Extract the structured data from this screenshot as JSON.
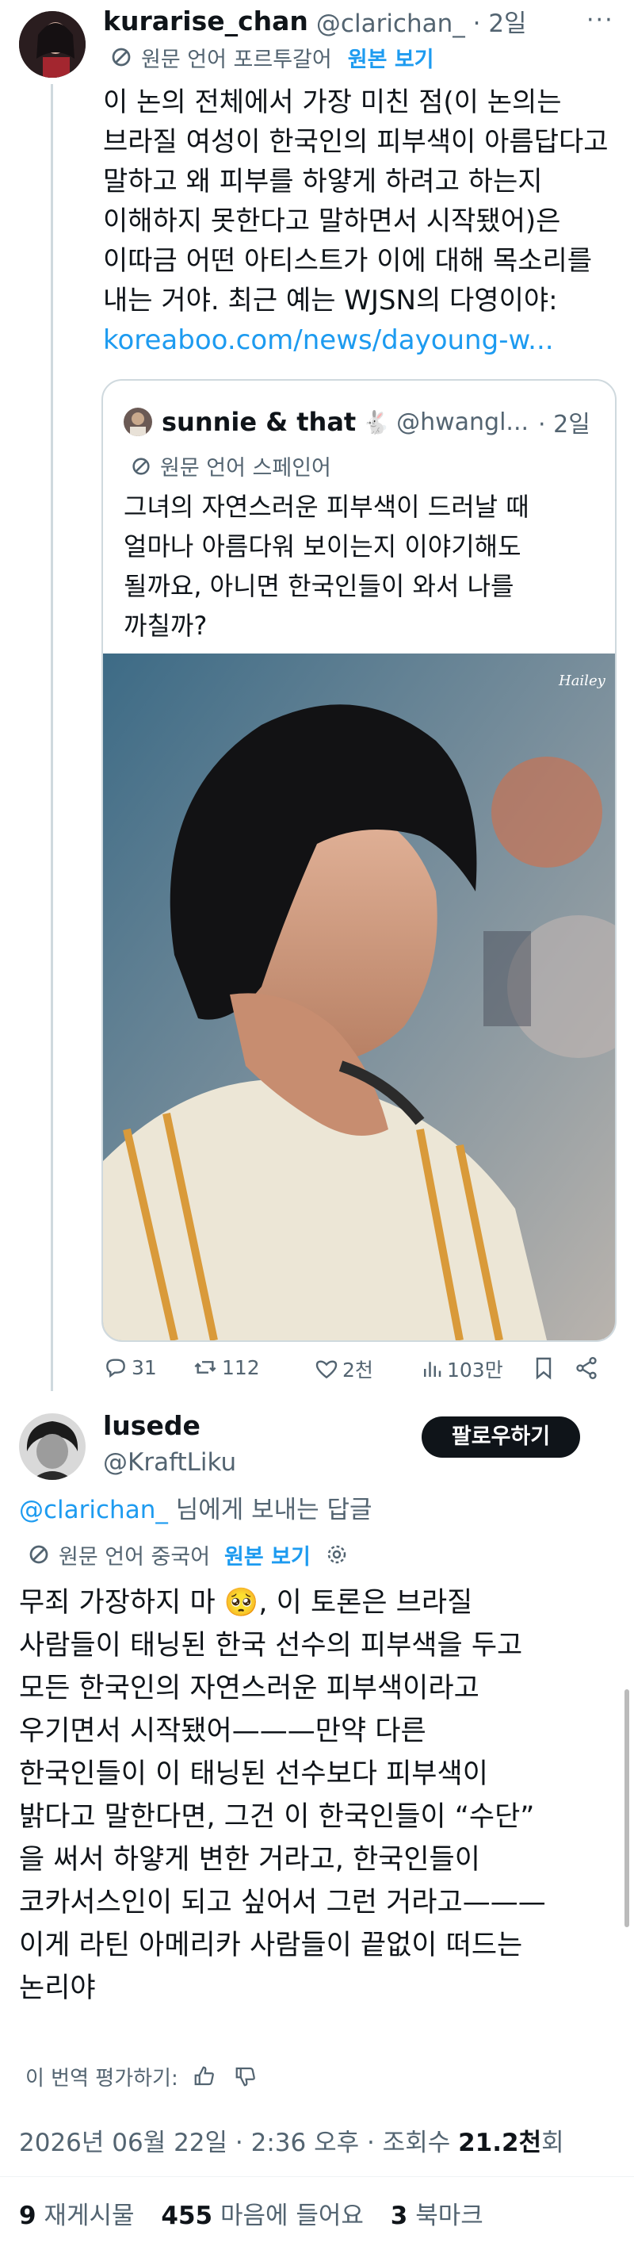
{
  "tweet1": {
    "display_name": "kurarise_chan",
    "handle_time": "@clarichan_ · 2일",
    "translate_note": "원문 언어 포르투갈어",
    "view_original": "원본 보기",
    "body_lines": [
      "이 논의 전체에서 가장 미친 점(이 논의는",
      "브라질 여성이 한국인의 피부색이 아름답다고",
      "말하고 왜 피부를 하얗게 하려고 하는지",
      "이해하지 못한다고 말하면서 시작됐어)은",
      "이따금 어떤 아티스트가 이에 대해 목소리를",
      "내는 거야. 최근 예는 WJSN의 다영이야:"
    ],
    "link": "koreaboo.com/news/dayoung-w...",
    "stats": {
      "replies": "31",
      "retweets": "112",
      "likes": "2천",
      "views": "103만"
    }
  },
  "quote": {
    "display_name": "sunnie & that",
    "handle": "@hwangl...",
    "time": "· 2일",
    "translate_note": "원문 언어 스페인어",
    "body_lines": [
      "그녀의 자연스러운 피부색이 드러날 때",
      "얼마나 아름다워 보이는지 이야기해도",
      "될까요, 아니면 한국인들이 와서 나를",
      "까칠까?"
    ],
    "watermark": "Hailey"
  },
  "tweet2": {
    "display_name": "lusede",
    "handle": "@KraftLiku",
    "follow_label": "팔로우하기",
    "reply_to_handle": "@clarichan_",
    "reply_to_suffix": " 님에게 보내는 답글",
    "translate_note": "원문 언어 중국어",
    "view_original": "원본 보기",
    "body_lines": [
      "무죄 가장하지 마 ",
      "사람들이 태닝된 한국 선수의 피부색을 두고",
      "모든 한국인의 자연스러운 피부색이라고",
      "우기면서 시작됐어———만약 다른",
      "한국인들이 이 태닝된 선수보다 피부색이",
      "밝다고 말한다면, 그건 이 한국인들이 “수단”",
      "을 써서 하얗게 변한 거라고, 한국인들이",
      "코카서스인이 되고 싶어서 그런 거라고———",
      "이게 라틴 아메리카 사람들이 끝없이 떠드는",
      "논리야"
    ],
    "first_line_rest": ", 이 토론은 브라질",
    "emoji": "🥺",
    "rate_label": "이 번역 평가하기:",
    "date_time": "2026년 06월 22일 · 2:36 오후 · 조회수 ",
    "views": "21.2천",
    "views_suffix": "회",
    "counts": {
      "reposts_num": "9",
      "reposts_label": " 재게시물",
      "likes_num": "455",
      "likes_label": " 마음에 들어요",
      "bookmarks_num": "3",
      "bookmarks_label": " 북마크"
    }
  },
  "colors": {
    "accent": "#1d9bf0",
    "text": "#0f1419",
    "muted": "#536471",
    "border": "#cfd9de"
  }
}
